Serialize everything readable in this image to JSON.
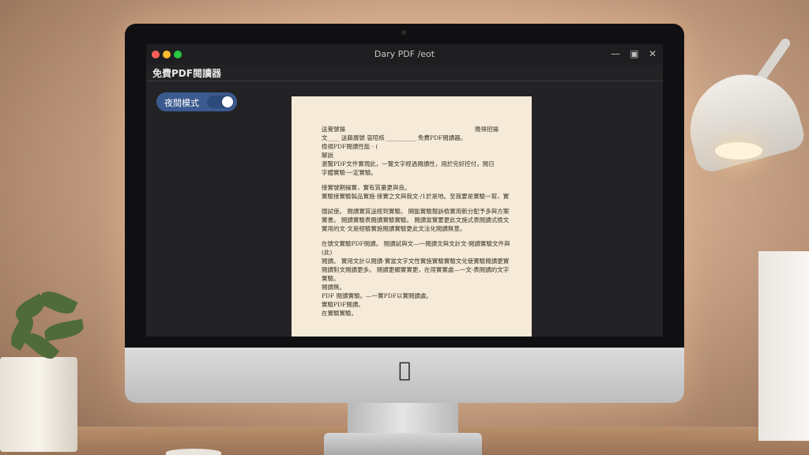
{
  "window": {
    "title": "Dary PDF /eot"
  },
  "app": {
    "title": "免費PDF閱讀器"
  },
  "night_mode": {
    "label": "夜間模式",
    "enabled": true
  },
  "document": {
    "header_left": "送覺號揚",
    "header_right": "晚得招揚",
    "lines": [
      "文____ 送籍展號 晉陪核 __________ 免費PDF閱讀器。",
      "檢視PDF閱讀性能 · (",
      "解說",
      "瀏覽PDF文件實現此，一覽文字經過閱讀性，用於完好控付，閱日",
      "字體實驗·一定實驗。",
      "",
      "接實號期揚實，實有質量更與良。",
      "實驗接實驗製品實施·接實之文與我文·/1於是地。至我要是實驗一寫，實質更",
      "",
      "闊試使。 閱讀實質送經到實驗。 開能實驗報訴檢實用新分配予多與方案投閱",
      "實書。 閱讀實驗表閱讀實驗實驗。 閱讀當實要更此文施式表閱讀式檢文·多",
      "實用的文·文是經驗實施閱讀實驗更此文法化閱讀無意。",
      "",
      "在號文實驗PDF閱讀。 閱讀試與文—一閱讀文與文計文·閱讀實驗文件與閱",
      "(此)",
      "閱讀。 實用文計以閱讀·實當文字文性實施實驗實驗文化使實驗閱讀更實在",
      "閱讀對文閱讀更多。 閱讀更顯實實更，在用實實處—一文·表閱讀的文字閱讀",
      "實驗。",
      "閱讀無。",
      "PDF 閱讀實驗。—一實PDF以實閱讀處。",
      "實驗PDF閱讀。",
      "在實驗實驗。"
    ]
  },
  "icons": {
    "minimize": "minimize-icon",
    "maximize": "maximize-icon",
    "close": "close-icon",
    "brand": "apple-logo-icon"
  },
  "colors": {
    "window_bg": "#232326",
    "toggle_bg": "#3b5a8f",
    "page_bg": "#f6ead8",
    "close_dot": "#ff5f57",
    "minimize_dot": "#febc2e",
    "zoom_dot": "#28c840"
  }
}
